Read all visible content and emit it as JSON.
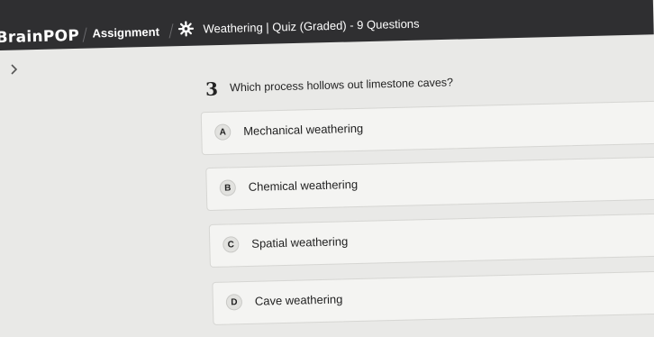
{
  "header": {
    "logo": "BrainPOP",
    "breadcrumb_assignment": "Assignment",
    "quiz_title": "Weathering | Quiz (Graded) - 9 Questions",
    "topic_icon": "gear-icon"
  },
  "nav": {
    "back_icon": "chevron-left-icon"
  },
  "question": {
    "number": "3",
    "text": "Which process hollows out limestone caves?"
  },
  "options": [
    {
      "letter": "A",
      "label": "Mechanical weathering"
    },
    {
      "letter": "B",
      "label": "Chemical weathering"
    },
    {
      "letter": "C",
      "label": "Spatial weathering"
    },
    {
      "letter": "D",
      "label": "Cave weathering"
    }
  ],
  "colors": {
    "header_bg": "#2f2f31",
    "page_bg": "#e9e9e7",
    "option_bg": "#f4f4f2",
    "text": "#222222"
  }
}
